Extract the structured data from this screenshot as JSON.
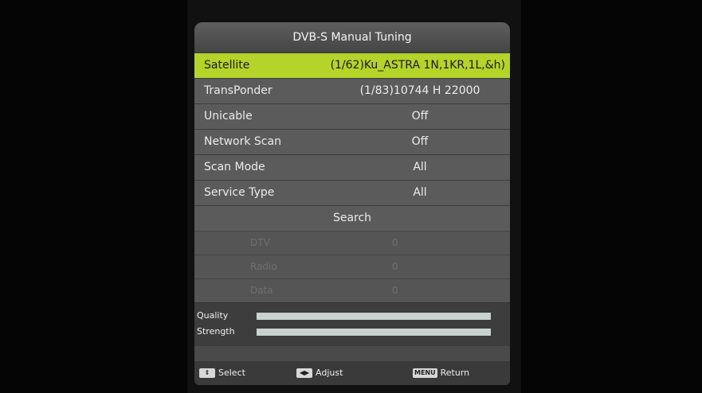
{
  "title": "DVB-S Manual Tuning",
  "rows": [
    {
      "label": "Satellite",
      "value": "(1/62)Ku_ASTRA 1N,1KR,1L,&h)"
    },
    {
      "label": "TransPonder",
      "value": "(1/83)10744 H 22000"
    },
    {
      "label": "Unicable",
      "value": "Off"
    },
    {
      "label": "Network Scan",
      "value": "Off"
    },
    {
      "label": "Scan Mode",
      "value": "All"
    },
    {
      "label": "Service Type",
      "value": "All"
    }
  ],
  "search_label": "Search",
  "results": [
    {
      "label": "DTV",
      "value": "0"
    },
    {
      "label": "Radio",
      "value": "0"
    },
    {
      "label": "Data",
      "value": "0"
    }
  ],
  "meters": {
    "quality": {
      "label": "Quality",
      "level": 1.0
    },
    "strength": {
      "label": "Strength",
      "level": 1.0
    }
  },
  "footer": {
    "select": {
      "key": "⇕",
      "label": "Select",
      "icon": "up-down-arrows-icon"
    },
    "adjust": {
      "key": "◀▶",
      "label": "Adjust",
      "icon": "left-right-arrows-icon"
    },
    "return": {
      "key": "MENU",
      "label": "Return",
      "icon": "menu-key-icon"
    }
  }
}
